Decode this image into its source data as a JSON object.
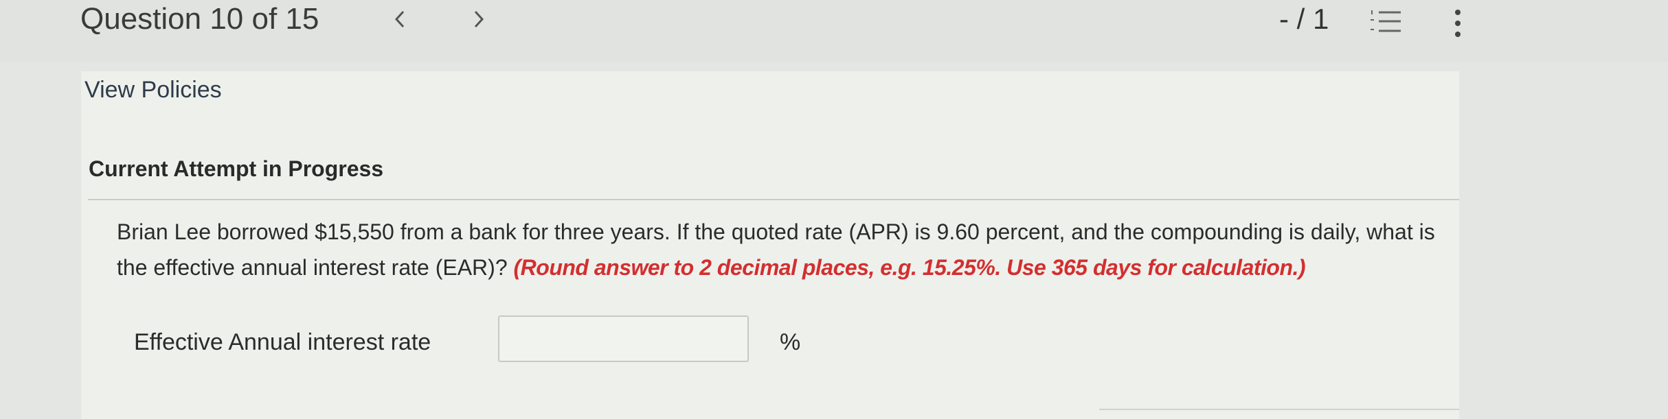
{
  "header": {
    "question_counter": "Question 10 of 15",
    "prev_label": "<",
    "next_label": ">",
    "score": "- / 1"
  },
  "icons": {
    "prev": "chevron-left-icon",
    "next": "chevron-right-icon",
    "list": "numbered-list-icon",
    "more": "vertical-ellipsis-icon"
  },
  "main": {
    "view_policies": "View Policies",
    "attempt_status": "Current Attempt in Progress",
    "question_text": "Brian Lee borrowed $15,550 from a bank for three years. If the quoted rate (APR) is 9.60 percent, and the compounding is daily, what is the effective annual interest rate (EAR)?",
    "question_hint": "(Round answer to 2 decimal places, e.g. 15.25%. Use 365 days for calculation.)",
    "answer": {
      "label": "Effective Annual interest rate",
      "value": "",
      "unit": "%"
    }
  },
  "colors": {
    "hint": "#d32f2f",
    "background": "#e4e6e3",
    "panel": "#eef0ec"
  }
}
